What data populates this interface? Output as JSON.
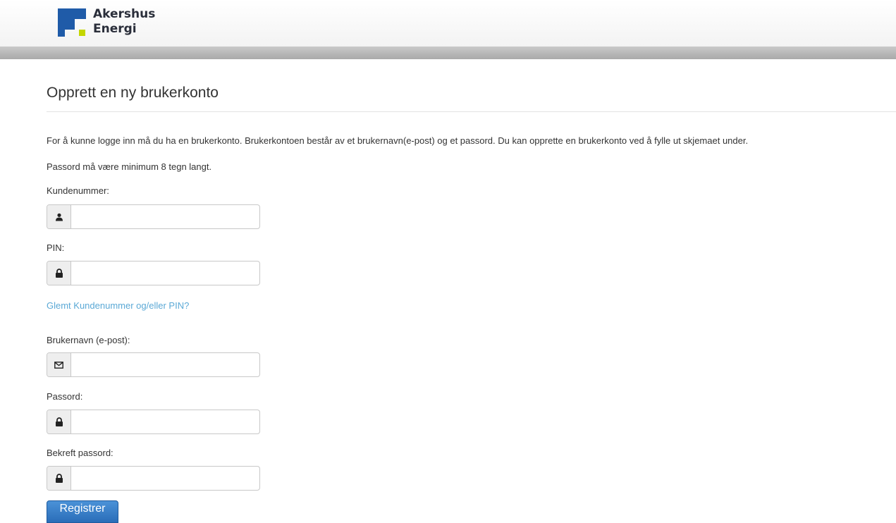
{
  "brand": {
    "name_line1": "Akershus",
    "name_line2": "Energi"
  },
  "page": {
    "title": "Opprett en ny brukerkonto",
    "intro": "For å kunne logge inn må du ha en brukerkonto. Brukerkontoen består av et brukernavn(e-post) og et passord. Du kan opprette en brukerkonto ved å fylle ut skjemaet under.",
    "password_rule": "Passord må være minimum 8 tegn langt."
  },
  "form": {
    "customer_number": {
      "label": "Kundenummer:",
      "value": "",
      "icon": "user-icon"
    },
    "pin": {
      "label": "PIN:",
      "value": "",
      "icon": "lock-icon"
    },
    "forgot_link": "Glemt Kundenummer og/eller PIN?",
    "username": {
      "label": "Brukernavn (e-post):",
      "value": "",
      "icon": "envelope-icon"
    },
    "password": {
      "label": "Passord:",
      "value": "",
      "icon": "lock-icon"
    },
    "confirm_password": {
      "label": "Bekreft passord:",
      "value": "",
      "icon": "lock-icon"
    },
    "submit_label": "Registrer"
  },
  "colors": {
    "brand_blue": "#1f5ba8",
    "brand_green": "#c4d600",
    "link": "#5ba9d6",
    "button": "#2a6db8"
  }
}
